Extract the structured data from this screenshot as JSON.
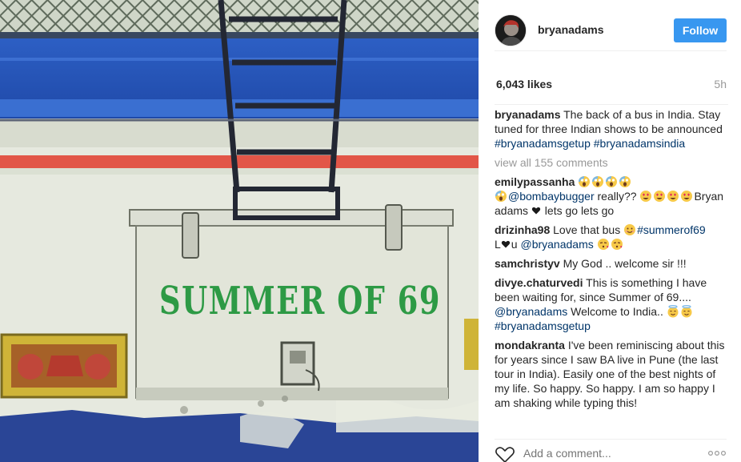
{
  "post": {
    "image_text": "SUMMER OF 69"
  },
  "header": {
    "username": "bryanadams",
    "follow_label": "Follow"
  },
  "stats": {
    "likes": "6,043 likes",
    "time": "5h"
  },
  "caption": {
    "user": "bryanadams",
    "text": "The back of a bus in India. Stay tuned for three Indian shows to be announced",
    "hashtag1": "#bryanadamsgetup",
    "hashtag2": "#bryanadamsindia"
  },
  "view_all": "view all 155 comments",
  "comments": [
    {
      "user": "emilypassanha",
      "mention": "@bombaybugger",
      "text1": " really?? ",
      "text2": "Bryan adams",
      "text3": " lets go lets go"
    },
    {
      "user": "drizinha98",
      "text1": "Love that bus ",
      "hashtag": "#summerof69",
      "text2": "L",
      "text3": "u ",
      "mention": "@bryanadams"
    },
    {
      "user": "samchristyv",
      "text": "My God .. welcome sir !!!"
    },
    {
      "user": "divye.chaturvedi",
      "text1": "This is something I have been waiting for, since Summer of 69.... ",
      "mention": "@bryanadams",
      "text2": " Welcome to India.. ",
      "hashtag": "#bryanadamsgetup"
    },
    {
      "user": "mondakranta",
      "text": "I've been reminiscing about this for years since I saw BA live in Pune (the last tour in India). Easily one of the best nights of my life. So happy. So happy. I am so happy I am shaking while typing this!"
    }
  ],
  "footer": {
    "placeholder": "Add a comment..."
  },
  "icons": {
    "scream": "scream-emoji-icon",
    "heart_eyes": "heart-eyes-emoji-icon",
    "smile": "smile-emoji-icon",
    "kiss": "kissing-heart-emoji-icon",
    "innocent": "innocent-emoji-icon",
    "heart": "black-heart-icon",
    "like": "heart-outline-icon",
    "more": "more-options-icon"
  },
  "colors": {
    "accent": "#3897f0",
    "link": "#003569",
    "muted": "#999999"
  }
}
